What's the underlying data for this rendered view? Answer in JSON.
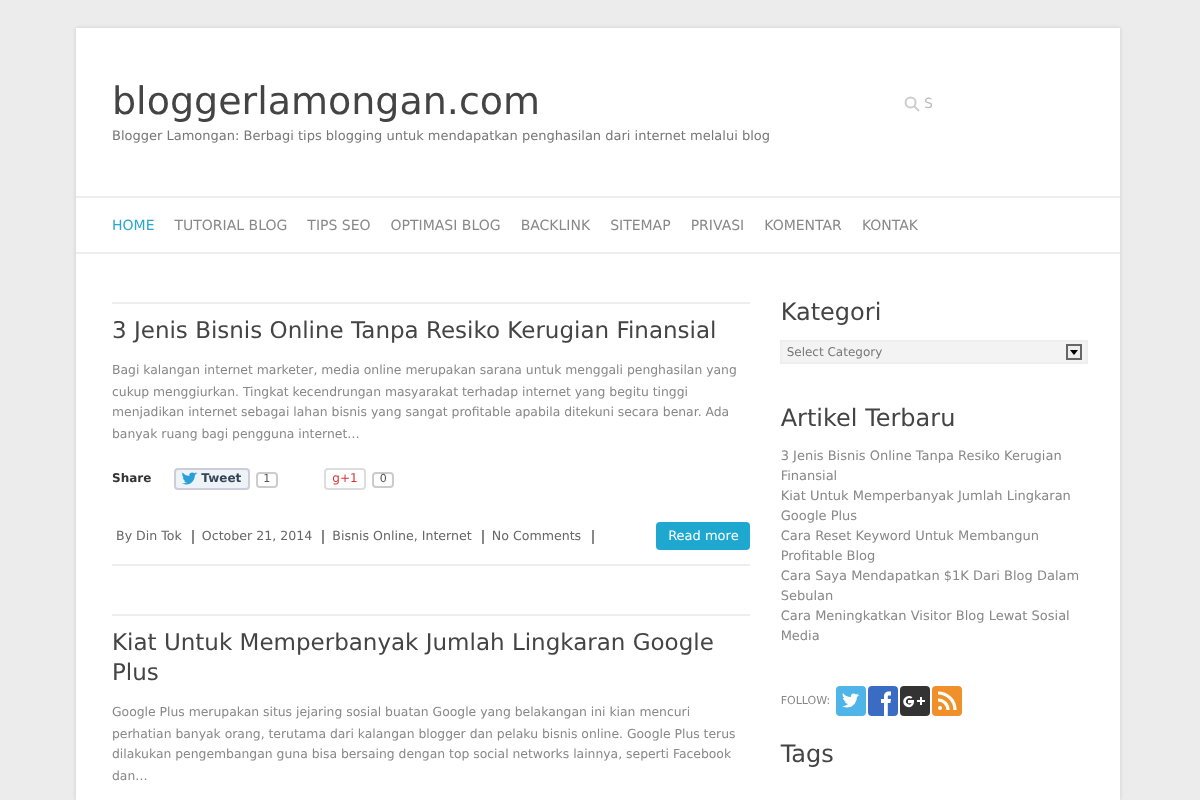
{
  "site": {
    "title": "bloggerlamongan.com",
    "tagline": "Blogger Lamongan: Berbagi tips blogging untuk mendapatkan penghasilan dari internet melalui blog",
    "search_placeholder": "S"
  },
  "nav": [
    {
      "label": "HOME",
      "selected": true
    },
    {
      "label": "TUTORIAL BLOG",
      "selected": false
    },
    {
      "label": "TIPS SEO",
      "selected": false
    },
    {
      "label": "OPTIMASI BLOG",
      "selected": false
    },
    {
      "label": "BACKLINK",
      "selected": false
    },
    {
      "label": "SITEMAP",
      "selected": false
    },
    {
      "label": "PRIVASI",
      "selected": false
    },
    {
      "label": "KOMENTAR",
      "selected": false
    },
    {
      "label": "KONTAK",
      "selected": false
    }
  ],
  "posts": [
    {
      "title": "3 Jenis Bisnis Online Tanpa Resiko Kerugian Finansial",
      "excerpt": "Bagi kalangan internet marketer, media online merupakan sarana untuk menggali penghasilan yang cukup menggiurkan. Tingkat kecendrungan masyarakat terhadap internet yang begitu tinggi menjadikan internet sebagai lahan bisnis yang sangat profitable apabila ditekuni secara benar. Ada banyak ruang bagi pengguna internet…",
      "share": {
        "label": "Share",
        "tweet": "Tweet",
        "tweet_count": "1",
        "gplus": "g+1",
        "gplus_count": "0"
      },
      "meta": [
        "By Din Tok",
        "October 21, 2014",
        "Bisnis Online, Internet",
        "No Comments"
      ],
      "read_more": "Read more"
    },
    {
      "title": "Kiat Untuk Memperbanyak Jumlah Lingkaran Google Plus",
      "excerpt": "Google Plus merupakan situs jejaring sosial buatan Google yang belakangan ini kian mencuri perhatian banyak orang, terutama dari kalangan blogger dan pelaku bisnis online. Google Plus terus dilakukan pengembangan guna bisa bersaing dengan top social networks lainnya, seperti Facebook dan…"
    }
  ],
  "sidebar": {
    "category_heading": "Kategori",
    "category_select": "Select Category",
    "recent_heading": "Artikel Terbaru",
    "recent": [
      "3 Jenis Bisnis Online Tanpa Resiko Kerugian Finansial",
      "Kiat Untuk Memperbanyak Jumlah Lingkaran Google Plus",
      "Cara Reset Keyword Untuk Membangun Profitable Blog",
      "Cara Saya Mendapatkan $1K Dari Blog Dalam Sebulan",
      "Cara Meningkatkan Visitor Blog Lewat Sosial Media"
    ],
    "follow_label": "FOLLOW:",
    "follow": [
      {
        "kind": "twitter"
      },
      {
        "kind": "facebook"
      },
      {
        "kind": "gplus"
      },
      {
        "kind": "rss"
      }
    ],
    "tags_heading": "Tags"
  }
}
